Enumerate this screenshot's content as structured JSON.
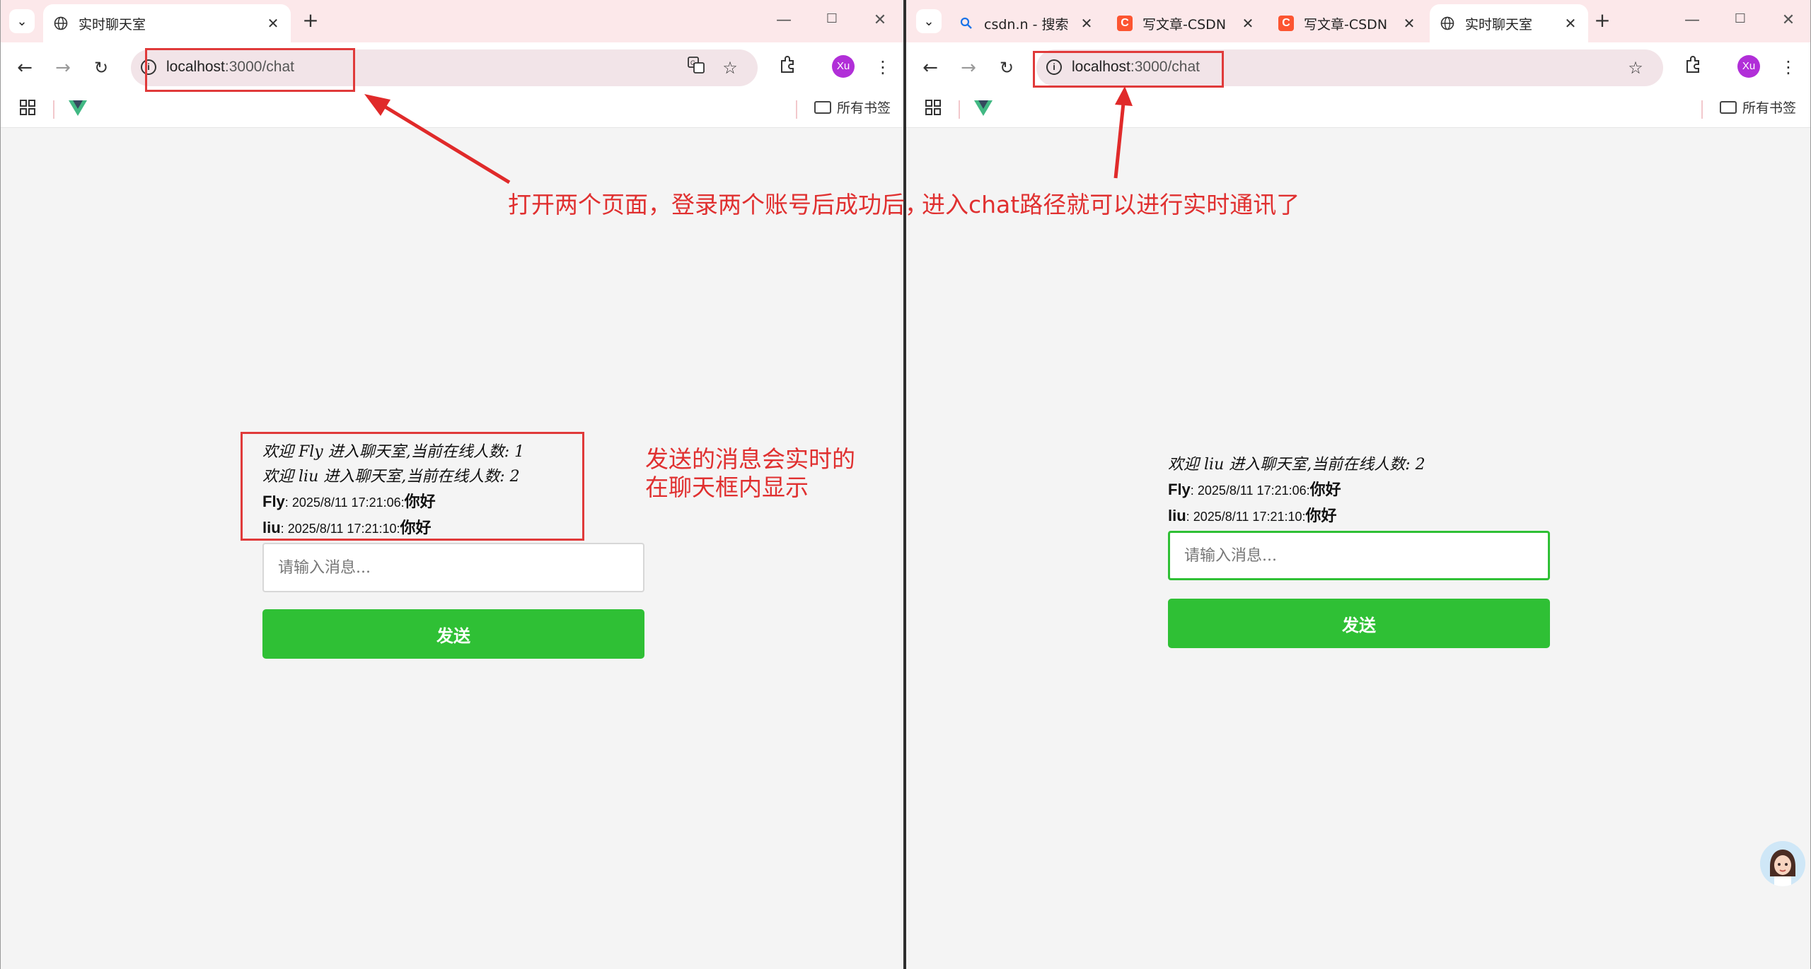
{
  "left_window": {
    "tabs": [
      {
        "title": "实时聊天室",
        "active": true
      }
    ],
    "address": {
      "host": "localhost",
      "path": ":3000/chat"
    },
    "bookmarks": {
      "all_label": "所有书签"
    },
    "profile": "Xu",
    "chat": {
      "messages": [
        {
          "type": "system",
          "text": "欢迎 Fly 进入聊天室,当前在线人数: 1"
        },
        {
          "type": "system",
          "text": "欢迎 liu 进入聊天室,当前在线人数: 2"
        },
        {
          "type": "user",
          "user": "Fly",
          "sep": ": ",
          "time": "2025/8/11 17:21:06",
          "colon": ":",
          "text": "你好"
        },
        {
          "type": "user",
          "user": "liu",
          "sep": ": ",
          "time": "2025/8/11 17:21:10",
          "colon": ":",
          "text": "你好"
        }
      ],
      "input_placeholder": "请输入消息...",
      "send_label": "发送"
    }
  },
  "right_window": {
    "tabs": [
      {
        "title": "csdn.n - 搜索",
        "icon": "search-icon"
      },
      {
        "title": "写文章-CSDN",
        "icon": "csdn-icon"
      },
      {
        "title": "写文章-CSDN",
        "icon": "csdn-icon"
      },
      {
        "title": "实时聊天室",
        "icon": "globe-icon",
        "active": true
      }
    ],
    "address": {
      "host": "localhost",
      "path": ":3000/chat"
    },
    "bookmarks": {
      "all_label": "所有书签"
    },
    "profile": "Xu",
    "chat": {
      "messages": [
        {
          "type": "system",
          "text": "欢迎 liu 进入聊天室,当前在线人数: 2"
        },
        {
          "type": "user",
          "user": "Fly",
          "sep": ": ",
          "time": "2025/8/11 17:21:06",
          "colon": ":",
          "text": "你好"
        },
        {
          "type": "user",
          "user": "liu",
          "sep": ": ",
          "time": "2025/8/11 17:21:10",
          "colon": ":",
          "text": "你好"
        }
      ],
      "input_placeholder": "请输入消息...",
      "send_label": "发送"
    }
  },
  "annotations": {
    "top_part1": "打开两个页面，登录两个账号后成功后，",
    "top_part2": "进入chat路径就可以进行实时通讯了",
    "side_line1": "发送的消息会实时的",
    "side_line2": "在聊天框内显示"
  },
  "colors": {
    "accent_green": "#2fc035",
    "annotation_red": "#e03030",
    "chrome_pink": "#fce8ea",
    "profile_purple": "#b12fd8"
  }
}
